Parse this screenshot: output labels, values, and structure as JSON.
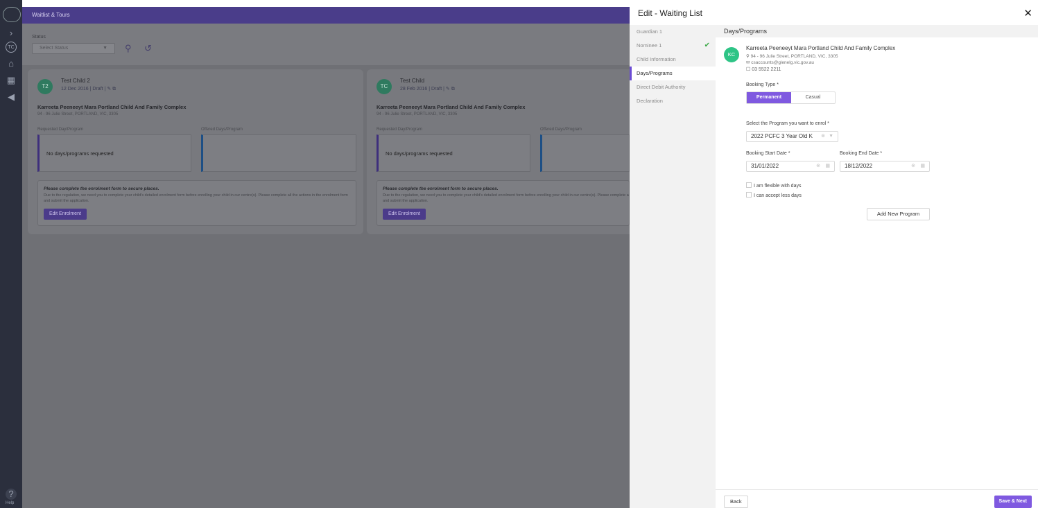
{
  "app": {
    "topbar_title": "Waitlist & Tours",
    "rail_icons": [
      "chevron-right-icon",
      "user-circle-icon",
      "home-icon",
      "calendar-icon",
      "megaphone-icon"
    ],
    "help_label": "Help"
  },
  "filter": {
    "status_label": "Status",
    "status_placeholder": "Select Status"
  },
  "cards": [
    {
      "initials": "T2",
      "name": "Test Child 2",
      "date": "12 Dec 2016",
      "status": "Draft",
      "centre": "Karreeta Peeneeyt Mara Portland Child And Family Complex",
      "address": "94 - 96 Julie Street, PORTLAND, VIC, 3305",
      "requested_label": "Requested Day/Program",
      "offered_label": "Offered Days/Program",
      "requested_text": "No days/programs requested",
      "notice_title": "Please complete the enrolment form to secure places.",
      "notice_text": "Due to the regulation, we need you to complete your child's detailed enrolment form before enrolling your child in our centre(s). Please complete all the actions in the enrolment form and submit the application.",
      "button": "Edit Enrolment"
    },
    {
      "initials": "TC",
      "name": "Test Child",
      "date": "28 Feb 2016",
      "status": "Draft",
      "centre": "Karreeta Peeneeyt Mara Portland Child And Family Complex",
      "address": "94 - 96 Julie Street, PORTLAND, VIC, 3305",
      "requested_label": "Requested Day/Program",
      "offered_label": "Offered Days/Program",
      "requested_text": "No days/programs requested",
      "notice_title": "Please complete the enrolment form to secure places.",
      "notice_text": "Due to the regulation, we need you to complete your child's detailed enrolment form before enrolling your child in our centre(s). Please complete all the actions in the enrolment form and submit the application.",
      "button": "Edit Enrolment"
    }
  ],
  "drawer": {
    "title": "Edit - Waiting List",
    "steps": [
      {
        "label": "Guardian 1",
        "done": false
      },
      {
        "label": "Nominee 1",
        "done": true
      },
      {
        "label": "Child Information",
        "done": false
      },
      {
        "label": "Days/Programs",
        "done": false,
        "active": true
      },
      {
        "label": "Direct Debit Authority",
        "done": false
      },
      {
        "label": "Declaration",
        "done": false
      }
    ],
    "section_title": "Days/Programs",
    "centre": {
      "initials": "KC",
      "name": "Karreeta Peeneeyt Mara Portland Child And Family Complex",
      "address": "94 - 96 Julie Street, PORTLAND, VIC, 3305",
      "email": "csaccounts@glenelg.vic.gov.au",
      "phone": "03 5522 2211"
    },
    "booking_type_label": "Booking Type *",
    "booking_types": [
      "Permanent",
      "Casual"
    ],
    "booking_type_selected": "Permanent",
    "program_label": "Select the Program you want to enrol *",
    "program_value": "2022 PCFC 3 Year Old K",
    "start_label": "Booking Start Date *",
    "start_value": "31/01/2022",
    "end_label": "Booking End Date *",
    "end_value": "18/12/2022",
    "flexible_label": "I am flexible with days",
    "less_days_label": "I can accept less days",
    "add_program": "Add New Program",
    "back": "Back",
    "save_next": "Save & Next"
  },
  "colors": {
    "accent": "#7f59e0",
    "topbar": "#4a3d8a",
    "check": "#39a845",
    "avatar": "#2ec486"
  }
}
